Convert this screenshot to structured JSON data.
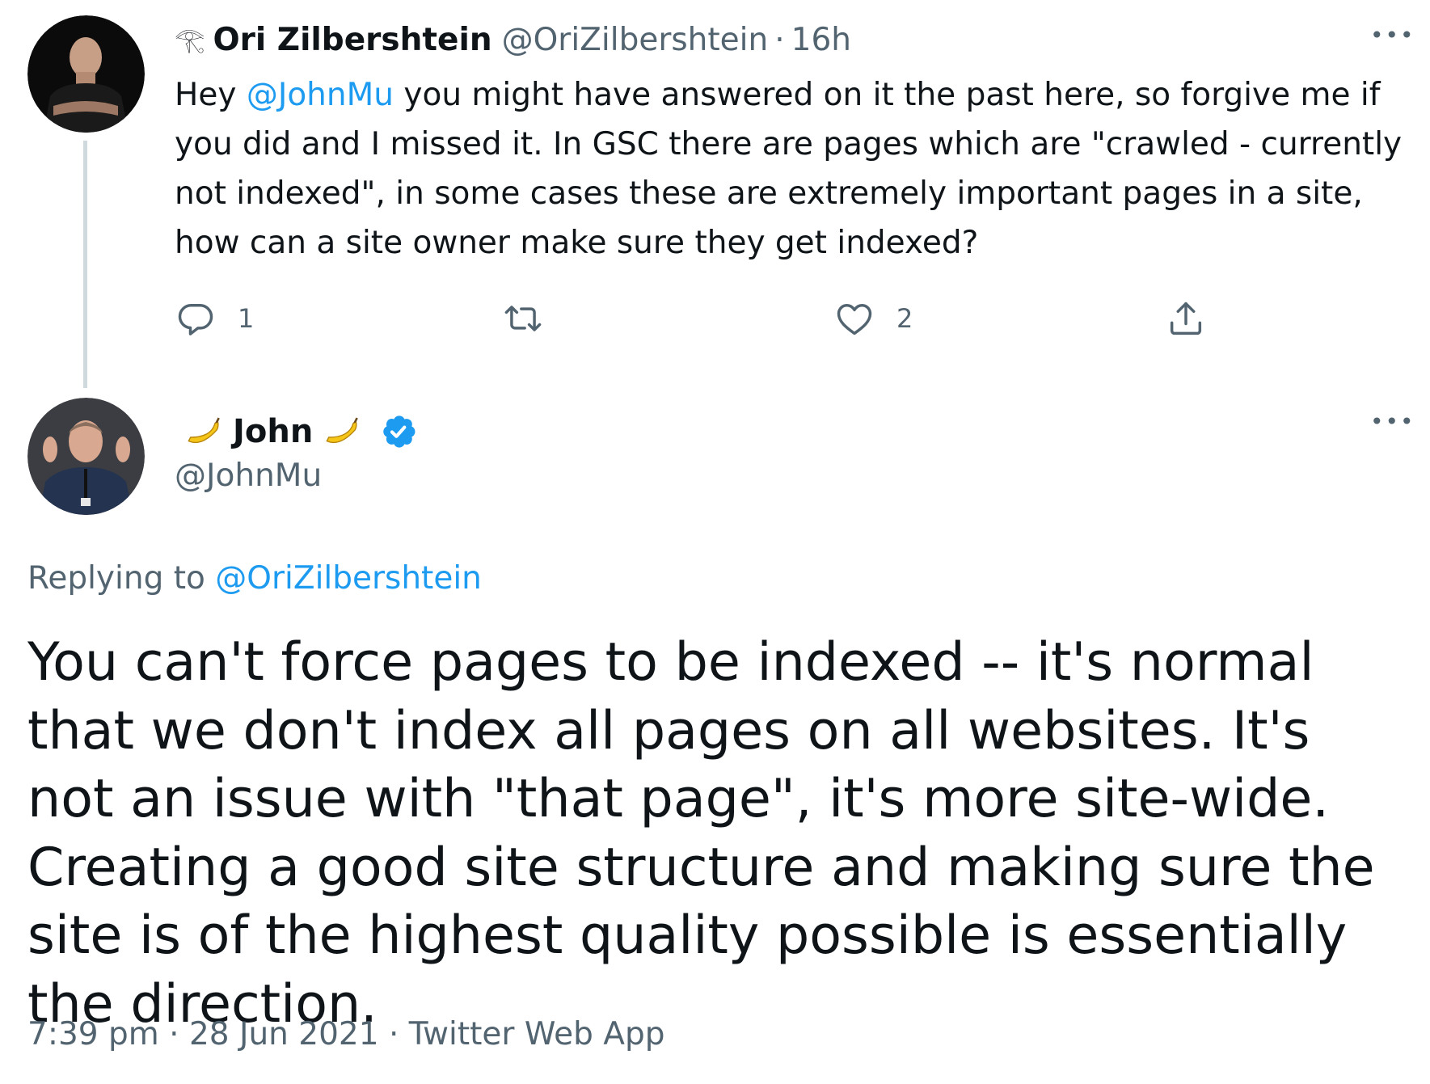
{
  "tweet1": {
    "author_name": "Ori Zilbershtein",
    "handle": "@OriZilbershtein",
    "separator": "·",
    "time": "16h",
    "more_label": "•••",
    "text": {
      "before": "Hey ",
      "mention": "@JohnMu",
      "after": " you might have answered on it the past here, so forgive me if you did and I missed it. In GSC there are pages which are \"crawled - currently not indexed\", in some cases these are extremely important pages in a site, how can a site owner make sure they get indexed?"
    },
    "actions": {
      "reply_count": "1",
      "retweet_count": "",
      "like_count": "2"
    },
    "icons": {
      "name_prefix": "eye-of-horus-icon",
      "reply": "reply-bubble-icon",
      "retweet": "retweet-icon",
      "like": "heart-icon",
      "share": "share-icon"
    }
  },
  "tweet2": {
    "author_name": "John",
    "handle": "@JohnMu",
    "more_label": "•••",
    "replying_prefix": "Replying to ",
    "replying_to": "@OriZilbershtein",
    "text": "You can't force pages to be indexed -- it's normal that we don't index all pages on all websites. It's not an issue with \"that page\", it's more site-wide. Creating a good site structure and making sure the site is of the highest quality possible is essentially the direction.",
    "meta": {
      "time": "7:39 pm",
      "sep": " · ",
      "date": "28 Jun 2021",
      "source": "Twitter Web App"
    },
    "icons": {
      "name_decoration": "banana-icon",
      "verified": "verified-badge-icon"
    }
  },
  "colors": {
    "text_primary": "#0f1419",
    "text_secondary": "#536471",
    "link": "#1d9bf0",
    "thread_line": "#cfd9de",
    "verified": "#1d9bf0",
    "banana": "#f5c518"
  }
}
